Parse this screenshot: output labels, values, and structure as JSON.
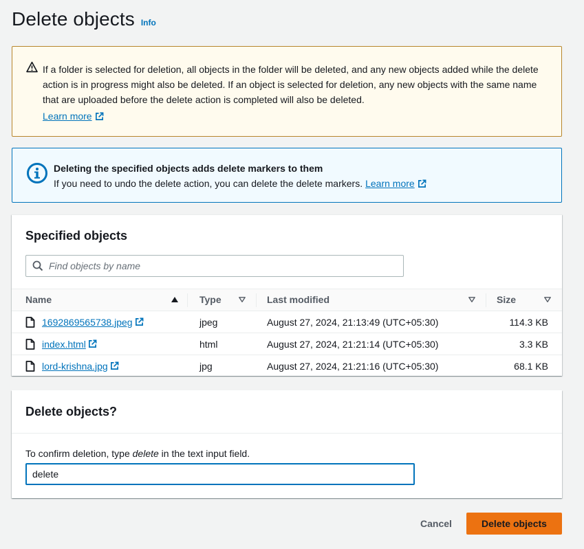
{
  "header": {
    "title": "Delete objects",
    "info_label": "Info"
  },
  "warning_alert": {
    "message": "If a folder is selected for deletion, all objects in the folder will be deleted, and any new objects added while the delete action is in progress might also be deleted. If an object is selected for deletion, any new objects with the same name that are uploaded before the delete action is completed will also be deleted.",
    "learn_more": "Learn more"
  },
  "info_alert": {
    "title": "Deleting the specified objects adds delete markers to them",
    "body": "If you need to undo the delete action, you can delete the delete markers.",
    "learn_more": "Learn more"
  },
  "objects": {
    "title": "Specified objects",
    "search_placeholder": "Find objects by name",
    "columns": {
      "name": "Name",
      "type": "Type",
      "last_modified": "Last modified",
      "size": "Size"
    },
    "rows": [
      {
        "name": "1692869565738.jpeg",
        "type": "jpeg",
        "last_modified": "August 27, 2024, 21:13:49 (UTC+05:30)",
        "size": "114.3 KB"
      },
      {
        "name": "index.html",
        "type": "html",
        "last_modified": "August 27, 2024, 21:21:14 (UTC+05:30)",
        "size": "3.3 KB"
      },
      {
        "name": "lord-krishna.jpg",
        "type": "jpg",
        "last_modified": "August 27, 2024, 21:21:16 (UTC+05:30)",
        "size": "68.1 KB"
      }
    ]
  },
  "confirm": {
    "title": "Delete objects?",
    "label_prefix": "To confirm deletion, type ",
    "label_keyword": "delete",
    "label_suffix": " in the text input field.",
    "input_value": "delete"
  },
  "actions": {
    "cancel": "Cancel",
    "delete": "Delete objects"
  },
  "colors": {
    "primary_button": "#ec7211",
    "link": "#0073bb",
    "warning_border": "#b7852a",
    "info_border": "#0073bb"
  }
}
